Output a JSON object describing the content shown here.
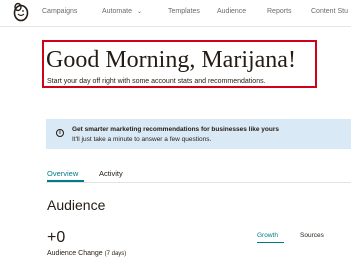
{
  "nav": {
    "items": [
      {
        "label": "Campaigns"
      },
      {
        "label": "Automate"
      },
      {
        "label": "Templates"
      },
      {
        "label": "Audience"
      },
      {
        "label": "Reports"
      },
      {
        "label": "Content Stu"
      }
    ]
  },
  "greeting": {
    "title": "Good Morning, Marijana!",
    "subtitle": "Start your day off right with some account stats and recommendations."
  },
  "banner": {
    "title": "Get smarter marketing recommendations for businesses like yours",
    "text": "It'll just take a minute to answer a few questions."
  },
  "tabs": [
    {
      "label": "Overview",
      "active": true
    },
    {
      "label": "Activity",
      "active": false
    }
  ],
  "audience": {
    "title": "Audience",
    "change_value": "+0",
    "change_label": "Audience Change",
    "change_period": "(7 days)",
    "subtabs": [
      {
        "label": "Growth",
        "active": true
      },
      {
        "label": "Sources",
        "active": false
      }
    ]
  },
  "colors": {
    "accent": "#007c89",
    "highlight_border": "#d0021b",
    "banner_bg": "#d9e9f5"
  }
}
